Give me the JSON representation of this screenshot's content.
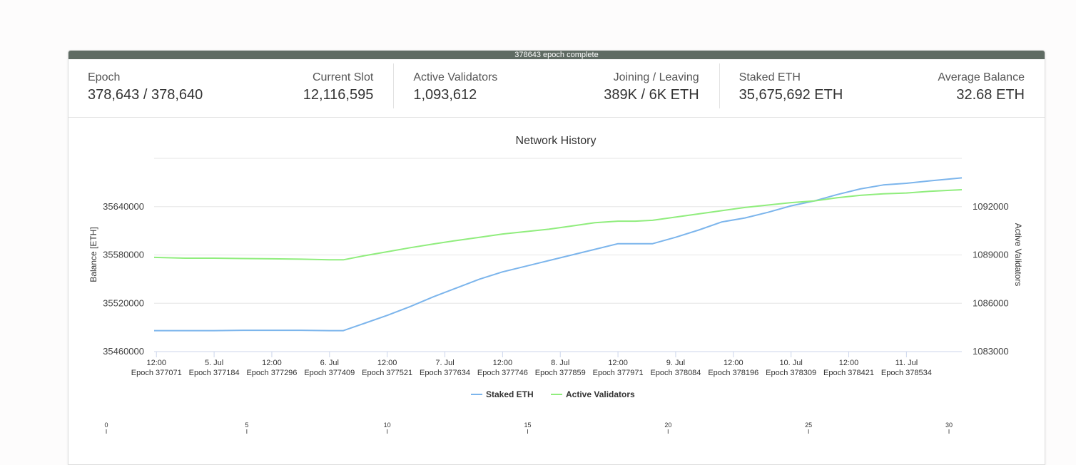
{
  "progress": {
    "label": "378643 epoch complete"
  },
  "stats": {
    "epoch": {
      "label": "Epoch",
      "value": "378,643 / 378,640"
    },
    "current_slot": {
      "label": "Current Slot",
      "value": "12,116,595"
    },
    "active_validators": {
      "label": "Active Validators",
      "value": "1,093,612"
    },
    "joining_leaving": {
      "label": "Joining / Leaving",
      "value": "389K / 6K ETH"
    },
    "staked_eth": {
      "label": "Staked ETH",
      "value": "35,675,692 ETH"
    },
    "average_balance": {
      "label": "Average Balance",
      "value": "32.68 ETH"
    }
  },
  "colors": {
    "staked": "#7cb5ec",
    "validators": "#90ed7d",
    "progress_bar": "#5f6b63"
  },
  "chart_data": {
    "type": "line",
    "title": "Network History",
    "ylabel_left": "Balance [ETH]",
    "ylabel_right": "Active Validators",
    "ylim_left": [
      35460000,
      35700000
    ],
    "ylim_right": [
      1083000,
      1095000
    ],
    "yticks_left": [
      "35460000",
      "35520000",
      "35580000",
      "35640000"
    ],
    "yticks_right": [
      "1083000",
      "1086000",
      "1089000",
      "1092000"
    ],
    "xlim": [
      -0.02,
      6.98
    ],
    "xticks": [
      {
        "x": 0.0,
        "label": "12:00",
        "epoch": "Epoch 377071"
      },
      {
        "x": 0.5,
        "label": "5. Jul",
        "epoch": "Epoch 377184"
      },
      {
        "x": 1.0,
        "label": "12:00",
        "epoch": "Epoch 377296"
      },
      {
        "x": 1.5,
        "label": "6. Jul",
        "epoch": "Epoch 377409"
      },
      {
        "x": 2.0,
        "label": "12:00",
        "epoch": "Epoch 377521"
      },
      {
        "x": 2.5,
        "label": "7. Jul",
        "epoch": "Epoch 377634"
      },
      {
        "x": 3.0,
        "label": "12:00",
        "epoch": "Epoch 377746"
      },
      {
        "x": 3.5,
        "label": "8. Jul",
        "epoch": "Epoch 377859"
      },
      {
        "x": 4.0,
        "label": "12:00",
        "epoch": "Epoch 377971"
      },
      {
        "x": 4.5,
        "label": "9. Jul",
        "epoch": "Epoch 378084"
      },
      {
        "x": 5.0,
        "label": "12:00",
        "epoch": "Epoch 378196"
      },
      {
        "x": 5.5,
        "label": "10. Jul",
        "epoch": "Epoch 378309"
      },
      {
        "x": 6.0,
        "label": "12:00",
        "epoch": "Epoch 378421"
      },
      {
        "x": 6.5,
        "label": "11. Jul",
        "epoch": "Epoch 378534"
      }
    ],
    "series": [
      {
        "name": "Staked ETH",
        "axis": "left",
        "x": [
          -0.02,
          0.25,
          0.5,
          0.75,
          1.0,
          1.25,
          1.5,
          1.62,
          1.8,
          2.0,
          2.2,
          2.4,
          2.6,
          2.8,
          3.0,
          3.2,
          3.4,
          3.6,
          3.8,
          4.0,
          4.15,
          4.3,
          4.5,
          4.7,
          4.9,
          5.1,
          5.3,
          5.5,
          5.7,
          5.9,
          6.1,
          6.3,
          6.5,
          6.7,
          6.98
        ],
        "values": [
          35486000,
          35486000,
          35486000,
          35486500,
          35486500,
          35486500,
          35486000,
          35486000,
          35495000,
          35505000,
          35516000,
          35528000,
          35539000,
          35550000,
          35559000,
          35566000,
          35573000,
          35580000,
          35587000,
          35594000,
          35594000,
          35594000,
          35602000,
          35611000,
          35621000,
          35626000,
          35633000,
          35641000,
          35647000,
          35655000,
          35662000,
          35667000,
          35669000,
          35672000,
          35675692
        ]
      },
      {
        "name": "Active Validators",
        "axis": "right",
        "x": [
          -0.02,
          0.25,
          0.5,
          0.75,
          1.0,
          1.25,
          1.5,
          1.62,
          1.8,
          2.0,
          2.2,
          2.4,
          2.6,
          2.8,
          3.0,
          3.2,
          3.4,
          3.6,
          3.8,
          4.0,
          4.15,
          4.3,
          4.5,
          4.7,
          4.9,
          5.1,
          5.3,
          5.5,
          5.7,
          5.9,
          6.1,
          6.3,
          6.5,
          6.7,
          6.98
        ],
        "values": [
          1088850,
          1088800,
          1088800,
          1088780,
          1088760,
          1088740,
          1088700,
          1088700,
          1088950,
          1089200,
          1089450,
          1089680,
          1089900,
          1090100,
          1090300,
          1090450,
          1090600,
          1090800,
          1091000,
          1091100,
          1091100,
          1091150,
          1091350,
          1091550,
          1091750,
          1091950,
          1092100,
          1092250,
          1092350,
          1092550,
          1092700,
          1092800,
          1092850,
          1092950,
          1093050
        ]
      }
    ],
    "legend": [
      "Staked ETH",
      "Active Validators"
    ],
    "legend_position": "bottom-center",
    "grid": true
  },
  "navigator": {
    "ticks": [
      "0",
      "5",
      "10",
      "15",
      "20",
      "25",
      "30"
    ]
  }
}
